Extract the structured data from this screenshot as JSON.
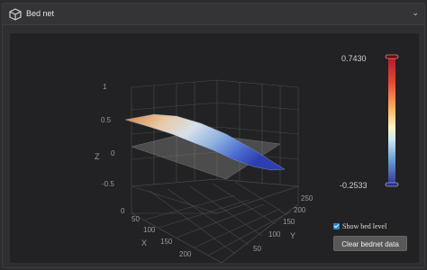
{
  "header": {
    "title": "Bed net",
    "icon": "cube-icon",
    "collapse_icon": "chevron-down-icon"
  },
  "colorbar": {
    "max": "0.7430",
    "min": "-0.2533"
  },
  "axes": {
    "z_label": "Z",
    "x_label": "X",
    "y_label": "Y",
    "z_ticks": [
      "1",
      "0.5",
      "0",
      "-0.5"
    ],
    "x_ticks": [
      "0",
      "50",
      "100",
      "150",
      "200"
    ],
    "y_ticks": [
      "250",
      "200",
      "150",
      "100",
      "50"
    ]
  },
  "controls": {
    "show_bed_level": "Show bed level",
    "show_bed_level_checked": true,
    "clear_button": "Clear bednet data"
  },
  "colors": {
    "panel_bg": "#2f2f31",
    "plot_bg": "#222224",
    "surface_high": "#d9843b",
    "surface_low": "#2d3fb0",
    "accent": "#1e88e5"
  }
}
